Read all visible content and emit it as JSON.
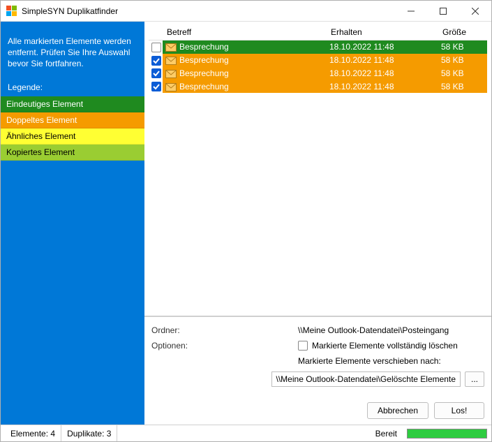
{
  "window": {
    "title": "SimpleSYN Duplikatfinder"
  },
  "sidebar": {
    "intro": "Alle markierten Elemente werden entfernt. Prüfen Sie Ihre Auswahl bevor Sie fortfahren.",
    "legend_title": "Legende:",
    "legend": {
      "unique": "Eindeutiges Element",
      "duplicate": "Doppeltes Element",
      "similar": "Ähnliches Element",
      "copied": "Kopiertes Element"
    }
  },
  "table": {
    "headers": {
      "subject": "Betreff",
      "received": "Erhalten",
      "size": "Größe"
    },
    "rows": [
      {
        "checked": false,
        "kind": "unique",
        "subject": "Besprechung",
        "received": "18.10.2022 11:48",
        "size": "58 KB"
      },
      {
        "checked": true,
        "kind": "dup",
        "subject": "Besprechung",
        "received": "18.10.2022 11:48",
        "size": "58 KB"
      },
      {
        "checked": true,
        "kind": "dup",
        "subject": "Besprechung",
        "received": "18.10.2022 11:48",
        "size": "58 KB"
      },
      {
        "checked": true,
        "kind": "dup",
        "subject": "Besprechung",
        "received": "18.10.2022 11:48",
        "size": "58 KB"
      }
    ]
  },
  "details": {
    "folder_label": "Ordner:",
    "folder_value": "\\\\Meine Outlook-Datendatei\\Posteingang",
    "options_label": "Optionen:",
    "delete_checkbox_label": "Markierte Elemente vollständig löschen",
    "delete_checked": false,
    "move_label": "Markierte Elemente verschieben nach:",
    "move_path": "\\\\Meine Outlook-Datendatei\\Gelöschte Elemente",
    "browse_label": "..."
  },
  "buttons": {
    "cancel": "Abbrechen",
    "go": "Los!"
  },
  "status": {
    "elements_label": "Elemente:",
    "elements_count": "4",
    "duplicates_label": "Duplikate:",
    "duplicates_count": "3",
    "ready": "Bereit"
  }
}
